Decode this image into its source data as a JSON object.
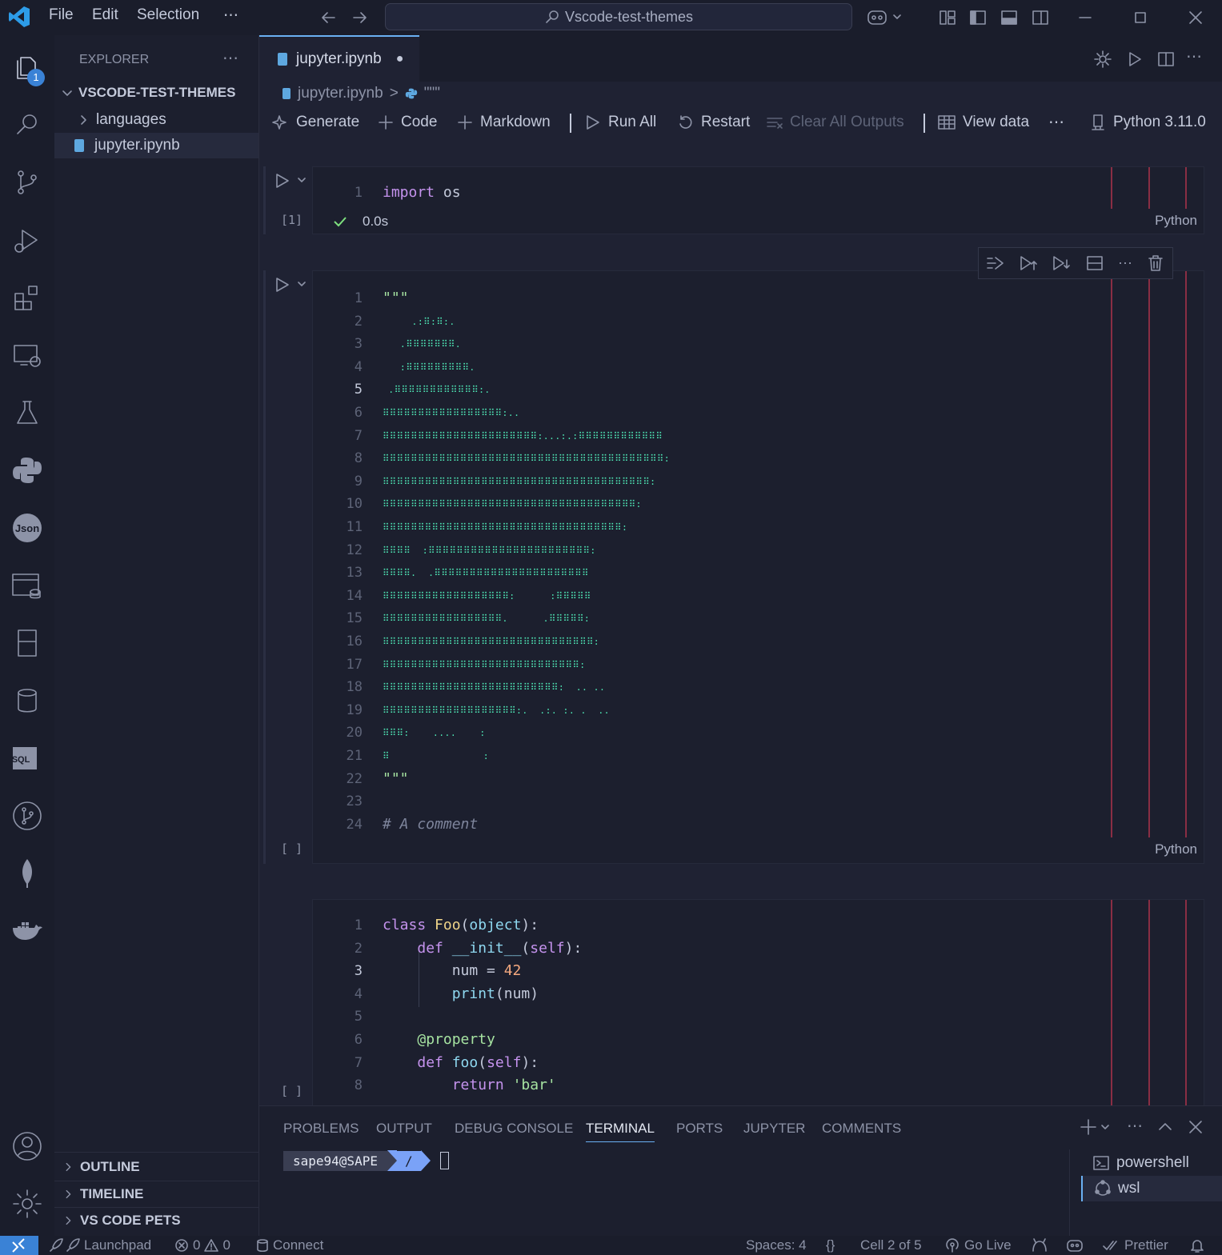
{
  "titlebar": {
    "menus": [
      "File",
      "Edit",
      "Selection",
      "⋯"
    ],
    "search": "Vscode-test-themes"
  },
  "activity": {
    "explorer_badge": "1",
    "icons": [
      "files-icon",
      "search-icon",
      "source-control-icon",
      "run-debug-icon",
      "extensions-icon",
      "remote-explorer-icon",
      "testing-icon",
      "python-icon",
      "json-icon",
      "database-explorer-icon",
      "notebook-icon",
      "cylinder-db-icon",
      "sql-icon",
      "git-graph-icon",
      "mongodb-leaf-icon",
      "docker-icon",
      "account-icon",
      "settings-gear-icon"
    ]
  },
  "sidebar": {
    "title": "EXPLORER",
    "more": "⋯",
    "folder": "VSCODE-TEST-THEMES",
    "items": [
      {
        "label": "languages",
        "type": "folder"
      },
      {
        "label": "jupyter.ipynb",
        "type": "file"
      }
    ],
    "sections": [
      "OUTLINE",
      "TIMELINE",
      "VS CODE PETS"
    ]
  },
  "tab": {
    "label": "jupyter.ipynb",
    "dirty": "●"
  },
  "breadcrumb": {
    "file": "jupyter.ipynb",
    "sep": ">",
    "symbol": "\"\"\""
  },
  "toolbar": {
    "generate": "Generate",
    "code": "Code",
    "markdown": "Markdown",
    "run_all": "Run All",
    "restart": "Restart",
    "clear": "Clear All Outputs",
    "view_data": "View data",
    "more": "⋯",
    "kernel": "Python 3.11.0"
  },
  "cell1": {
    "exec": "[1]",
    "time": "0.0s",
    "lang": "Python",
    "lines": [
      {
        "n": "1",
        "tokens": [
          [
            "kw",
            "import"
          ],
          [
            "",
            "os"
          ]
        ]
      }
    ]
  },
  "cell2": {
    "exec": "[ ]",
    "lang": "Python",
    "art": [
      "\"\"\"",
      "     .:⠿:⠿:.",
      "   .⠿⠿⠿⠿⠿⠿⠿.",
      "   :⠿⠿⠿⠿⠿⠿⠿⠿⠿.",
      " .⠿⠿⠿⠿⠿⠿⠿⠿⠿⠿⠿⠿:.",
      "⠿⠿⠿⠿⠿⠿⠿⠿⠿⠿⠿⠿⠿⠿⠿⠿⠿:..",
      "⠿⠿⠿⠿⠿⠿⠿⠿⠿⠿⠿⠿⠿⠿⠿⠿⠿⠿⠿⠿⠿⠿:...:.:⠿⠿⠿⠿⠿⠿⠿⠿⠿⠿⠿⠿",
      "⠿⠿⠿⠿⠿⠿⠿⠿⠿⠿⠿⠿⠿⠿⠿⠿⠿⠿⠿⠿⠿⠿⠿⠿⠿⠿⠿⠿⠿⠿⠿⠿⠿⠿⠿⠿⠿⠿⠿⠿:",
      "⠿⠿⠿⠿⠿⠿⠿⠿⠿⠿⠿⠿⠿⠿⠿⠿⠿⠿⠿⠿⠿⠿⠿⠿⠿⠿⠿⠿⠿⠿⠿⠿⠿⠿⠿⠿⠿⠿:",
      "⠿⠿⠿⠿⠿⠿⠿⠿⠿⠿⠿⠿⠿⠿⠿⠿⠿⠿⠿⠿⠿⠿⠿⠿⠿⠿⠿⠿⠿⠿⠿⠿⠿⠿⠿⠿:",
      "⠿⠿⠿⠿⠿⠿⠿⠿⠿⠿⠿⠿⠿⠿⠿⠿⠿⠿⠿⠿⠿⠿⠿⠿⠿⠿⠿⠿⠿⠿⠿⠿⠿⠿:",
      "⠿⠿⠿⠿  :⠿⠿⠿⠿⠿⠿⠿⠿⠿⠿⠿⠿⠿⠿⠿⠿⠿⠿⠿⠿⠿⠿⠿:",
      "⠿⠿⠿⠿.  .⠿⠿⠿⠿⠿⠿⠿⠿⠿⠿⠿⠿⠿⠿⠿⠿⠿⠿⠿⠿⠿⠿",
      "⠿⠿⠿⠿⠿⠿⠿⠿⠿⠿⠿⠿⠿⠿⠿⠿⠿⠿:      :⠿⠿⠿⠿⠿",
      "⠿⠿⠿⠿⠿⠿⠿⠿⠿⠿⠿⠿⠿⠿⠿⠿⠿.      .⠿⠿⠿⠿⠿:",
      "⠿⠿⠿⠿⠿⠿⠿⠿⠿⠿⠿⠿⠿⠿⠿⠿⠿⠿⠿⠿⠿⠿⠿⠿⠿⠿⠿⠿⠿⠿:",
      "⠿⠿⠿⠿⠿⠿⠿⠿⠿⠿⠿⠿⠿⠿⠿⠿⠿⠿⠿⠿⠿⠿⠿⠿⠿⠿⠿⠿:",
      "⠿⠿⠿⠿⠿⠿⠿⠿⠿⠿⠿⠿⠿⠿⠿⠿⠿⠿⠿⠿⠿⠿⠿⠿⠿:  .. ..",
      "⠿⠿⠿⠿⠿⠿⠿⠿⠿⠿⠿⠿⠿⠿⠿⠿⠿⠿⠿:.  .:. :. .  ..",
      "⠿⠿⠿:    ....    :",
      "⠿                :"
    ],
    "tail": [
      {
        "n": "22",
        "tokens": [
          [
            "str",
            "\"\"\""
          ]
        ]
      },
      {
        "n": "23",
        "tokens": []
      },
      {
        "n": "24",
        "tokens": [
          [
            "cm",
            "# A comment"
          ]
        ]
      }
    ]
  },
  "cell3": {
    "exec": "[ ]",
    "lines": [
      {
        "n": "1",
        "tokens": [
          [
            "kw",
            "class "
          ],
          [
            "cls",
            "Foo"
          ],
          [
            "",
            "("
          ],
          [
            "fn",
            "object"
          ],
          [
            "",
            "):"
          ]
        ]
      },
      {
        "n": "2",
        "tokens": [
          [
            "",
            "    "
          ],
          [
            "kw",
            "def "
          ],
          [
            "fn",
            "__init__"
          ],
          [
            "",
            "("
          ],
          [
            "kw",
            "self"
          ],
          [
            "",
            "):"
          ]
        ]
      },
      {
        "n": "3",
        "tokens": [
          [
            "",
            "        num = "
          ],
          [
            "num",
            "42"
          ]
        ]
      },
      {
        "n": "4",
        "tokens": [
          [
            "",
            "        "
          ],
          [
            "fn",
            "print"
          ],
          [
            "",
            "(num)"
          ]
        ]
      },
      {
        "n": "5",
        "tokens": []
      },
      {
        "n": "6",
        "tokens": [
          [
            "",
            "    "
          ],
          [
            "dec",
            "@property"
          ]
        ]
      },
      {
        "n": "7",
        "tokens": [
          [
            "",
            "    "
          ],
          [
            "kw",
            "def "
          ],
          [
            "fn",
            "foo"
          ],
          [
            "",
            "("
          ],
          [
            "kw",
            "self"
          ],
          [
            "",
            "):"
          ]
        ]
      },
      {
        "n": "8",
        "tokens": [
          [
            "",
            "        "
          ],
          [
            "kw",
            "return "
          ],
          [
            "str",
            "'bar'"
          ]
        ]
      }
    ]
  },
  "panel": {
    "tabs": [
      "PROBLEMS",
      "OUTPUT",
      "DEBUG CONSOLE",
      "TERMINAL",
      "PORTS",
      "JUPYTER",
      "COMMENTS"
    ],
    "active": "TERMINAL",
    "prompt_user": "sape94@SAPE",
    "prompt_path": "/",
    "terminals": [
      "powershell",
      "wsl"
    ]
  },
  "status": {
    "launchpad": "Launchpad",
    "errors": "0",
    "warnings": "0",
    "connect": "Connect",
    "spaces": "Spaces: 4",
    "braces": "{}",
    "cell": "Cell 2 of 5",
    "golive": "Go Live",
    "prettier": "Prettier"
  },
  "colors": {
    "accent": "#6ab0f3",
    "art": "#4ee4b4",
    "ruler": "#8a2e44",
    "success": "#7ee07e"
  }
}
